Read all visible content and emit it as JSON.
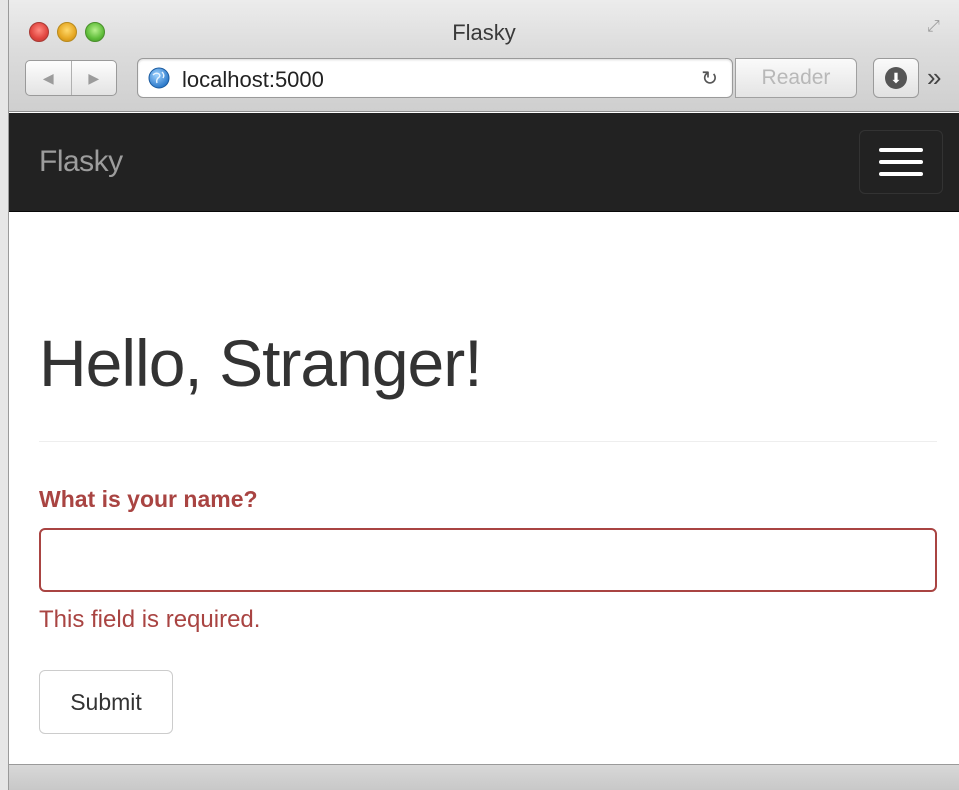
{
  "browser": {
    "window_title": "Flasky",
    "url": "localhost:5000",
    "reader_label": "Reader",
    "back_glyph": "◀",
    "forward_glyph": "▶",
    "reload_glyph": "↻",
    "download_glyph": "⬇",
    "overflow_glyph": "»",
    "fullscreen_glyph": "⤢",
    "traffic_colors": {
      "close": "#e0443e",
      "minimize": "#e6a723",
      "zoom": "#5fbd3a"
    }
  },
  "navbar": {
    "brand": "Flasky",
    "background": "#222222",
    "toggle_icon": "hamburger-menu-icon"
  },
  "page": {
    "heading": "Hello, Stranger!"
  },
  "form": {
    "name_label": "What is your name?",
    "name_value": "",
    "name_error": "This field is required.",
    "submit_label": "Submit",
    "error_color": "#a94442"
  }
}
